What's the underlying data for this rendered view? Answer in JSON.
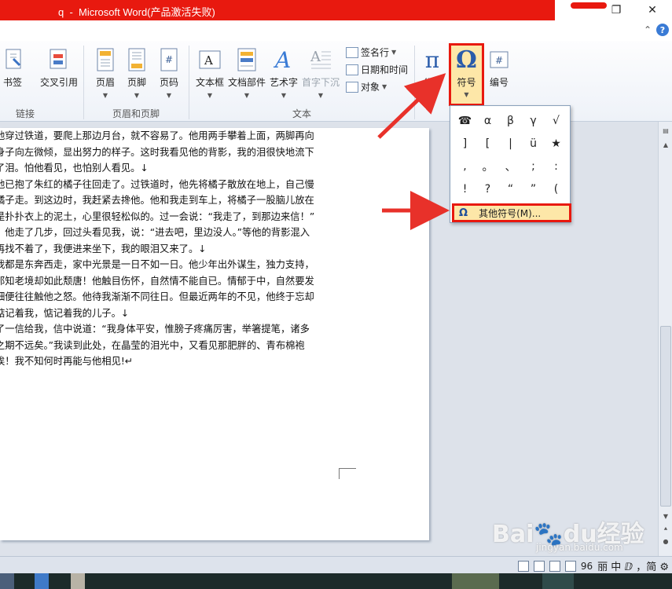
{
  "window": {
    "title": "q  -  Microsoft Word(产品激活失败)",
    "minimize": "",
    "restore": "❐",
    "close": "✕",
    "help_caret": "⌃",
    "help": "?"
  },
  "ribbon": {
    "bookmark_label": "书签",
    "crossref_label": "交叉引用",
    "links_group": "链接",
    "header_label": "页眉",
    "footer_label": "页脚",
    "pagenum_label": "页码",
    "header_footer_group": "页眉和页脚",
    "textbox_label": "文本框",
    "quickparts_label": "文档部件",
    "wordart_label": "艺术字",
    "dropcap_label": "首字下沉",
    "signature_label": "签名行",
    "datetime_label": "日期和时间",
    "object_label": "对象",
    "text_group": "文本",
    "equation_label": "公式",
    "symbol_label": "符号",
    "number_label": "编号"
  },
  "symbols": {
    "items": [
      "☎",
      "α",
      "β",
      "γ",
      "√",
      "]",
      "[",
      "|",
      "ü",
      "★",
      ",",
      "。",
      "、",
      ";",
      ":",
      "!",
      "?",
      "“",
      "”",
      "("
    ],
    "more_label": "其他符号(M)..."
  },
  "document": {
    "lines": [
      "他穿过铁道，要爬上那边月台，就不容易了。他用两手攀着上面，两脚再向",
      "身子向左微倾，显出努力的样子。这时我看见他的背影，我的泪很快地流下",
      "了泪。怕他看见，也怕别人看见。↓",
      "他已抱了朱红的橘子往回走了。过铁道时，他先将橘子散放在地上，自己慢",
      "橘子走。到这边时，我赶紧去搀他。他和我走到车上，将橘子一股脑儿放在",
      "是扑扑衣上的泥土，心里很轻松似的。过一会说：“我走了，到那边来信！”",
      "。他走了几步，回过头看见我，说：“进去吧，里边没人。”等他的背影混入",
      "再找不着了，我便进来坐下，我的眼泪又来了。↓",
      "我都是东奔西走，家中光景是一日不如一日。他少年出外谋生，独力支持，",
      "那知老境却如此颓唐！他触目伤怀，自然情不能自已。情郁于中，自然要发",
      "细便往往触他之怒。他待我渐渐不同往日。但最近两年的不见，他终于忘却",
      "惦记着我，惦记着我的儿子。↓",
      "了一信给我，信中说道：“我身体平安，惟膀子疼痛厉害，举箸提笔，诸多",
      "之期不远矣。”我读到此处，在晶莹的泪光中，又看见那肥胖的、青布棉袍",
      "唉！我不知何时再能与他相见!↵"
    ]
  },
  "status": {
    "zoom": "96",
    "ime": "丽 中 ⅅ ，简 ⚙"
  },
  "watermark": {
    "text": "Bai🐾du经验",
    "sub": "jingyan.baidu.com"
  },
  "colors": {
    "title_red": "#e8190f",
    "highlight": "#fde7a8",
    "arrow": "#e8312a"
  }
}
